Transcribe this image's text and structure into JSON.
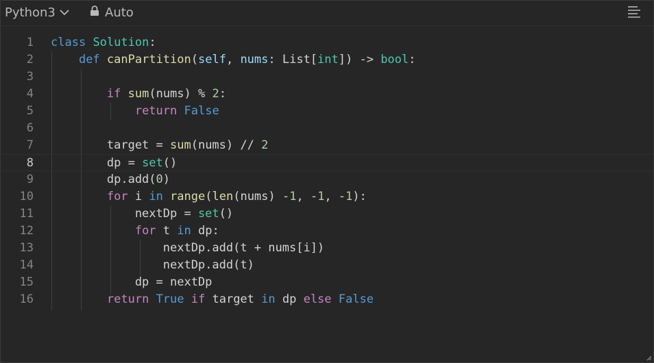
{
  "toolbar": {
    "language_label": "Python3",
    "language_icon": "chevron-down-icon",
    "mode_label": "Auto",
    "mode_icon": "lock-icon",
    "menu_icon": "align-left-icon"
  },
  "editor": {
    "line_numbers": [
      "1",
      "2",
      "3",
      "4",
      "5",
      "6",
      "7",
      "8",
      "9",
      "10",
      "11",
      "12",
      "13",
      "14",
      "15",
      "16"
    ],
    "active_line": 8,
    "lines": [
      [
        [
          "kw",
          "class"
        ],
        [
          "plain",
          " "
        ],
        [
          "cls",
          "Solution"
        ],
        [
          "plain",
          ":"
        ]
      ],
      [
        [
          "plain",
          "    "
        ],
        [
          "kw",
          "def"
        ],
        [
          "plain",
          " "
        ],
        [
          "fn",
          "canPartition"
        ],
        [
          "plain",
          "("
        ],
        [
          "var",
          "self"
        ],
        [
          "plain",
          ", "
        ],
        [
          "var",
          "nums"
        ],
        [
          "plain",
          ": List["
        ],
        [
          "cls",
          "int"
        ],
        [
          "plain",
          "]) -> "
        ],
        [
          "cls",
          "bool"
        ],
        [
          "plain",
          ":"
        ]
      ],
      [],
      [
        [
          "plain",
          "        "
        ],
        [
          "ctl",
          "if"
        ],
        [
          "plain",
          " "
        ],
        [
          "fn",
          "sum"
        ],
        [
          "plain",
          "(nums) % "
        ],
        [
          "num",
          "2"
        ],
        [
          "plain",
          ":"
        ]
      ],
      [
        [
          "plain",
          "            "
        ],
        [
          "ctl",
          "return"
        ],
        [
          "plain",
          " "
        ],
        [
          "kw",
          "False"
        ]
      ],
      [],
      [
        [
          "plain",
          "        target = "
        ],
        [
          "fn",
          "sum"
        ],
        [
          "plain",
          "(nums) // "
        ],
        [
          "num",
          "2"
        ]
      ],
      [
        [
          "plain",
          "        dp = "
        ],
        [
          "cls",
          "set"
        ],
        [
          "plain",
          "()"
        ]
      ],
      [
        [
          "plain",
          "        dp.add("
        ],
        [
          "num",
          "0"
        ],
        [
          "plain",
          ")"
        ]
      ],
      [
        [
          "plain",
          "        "
        ],
        [
          "ctl",
          "for"
        ],
        [
          "plain",
          " i "
        ],
        [
          "kw",
          "in"
        ],
        [
          "plain",
          " "
        ],
        [
          "fn",
          "range"
        ],
        [
          "plain",
          "("
        ],
        [
          "fn",
          "len"
        ],
        [
          "plain",
          "(nums) -"
        ],
        [
          "num",
          "1"
        ],
        [
          "plain",
          ", -"
        ],
        [
          "num",
          "1"
        ],
        [
          "plain",
          ", -"
        ],
        [
          "num",
          "1"
        ],
        [
          "plain",
          "):"
        ]
      ],
      [
        [
          "plain",
          "            nextDp = "
        ],
        [
          "cls",
          "set"
        ],
        [
          "plain",
          "()"
        ]
      ],
      [
        [
          "plain",
          "            "
        ],
        [
          "ctl",
          "for"
        ],
        [
          "plain",
          " t "
        ],
        [
          "kw",
          "in"
        ],
        [
          "plain",
          " dp:"
        ]
      ],
      [
        [
          "plain",
          "                nextDp.add(t + nums[i])"
        ]
      ],
      [
        [
          "plain",
          "                nextDp.add(t)"
        ]
      ],
      [
        [
          "plain",
          "            dp = nextDp"
        ]
      ],
      [
        [
          "plain",
          "        "
        ],
        [
          "ctl",
          "return"
        ],
        [
          "plain",
          " "
        ],
        [
          "kw",
          "True"
        ],
        [
          "plain",
          " "
        ],
        [
          "ctl",
          "if"
        ],
        [
          "plain",
          " target "
        ],
        [
          "kw",
          "in"
        ],
        [
          "plain",
          " dp "
        ],
        [
          "ctl",
          "else"
        ],
        [
          "plain",
          " "
        ],
        [
          "kw",
          "False"
        ]
      ]
    ]
  }
}
